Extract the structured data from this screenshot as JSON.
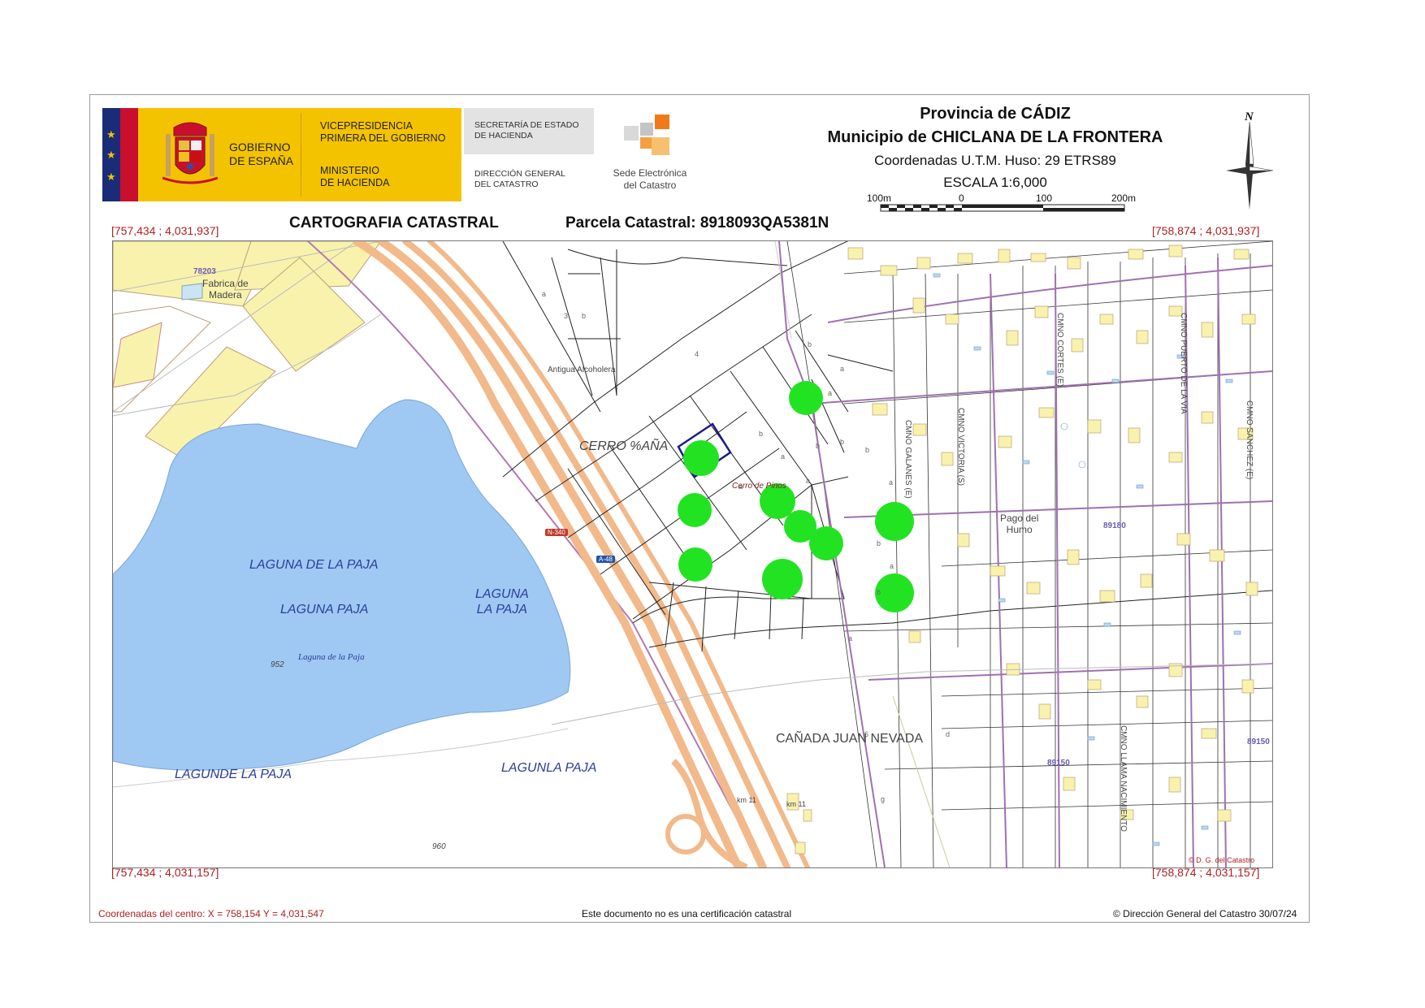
{
  "header": {
    "government": "GOBIERNO\nDE ESPAÑA",
    "vicepresidencia": "VICEPRESIDENCIA\nPRIMERA DEL GOBIERNO",
    "ministerio": "MINISTERIO\nDE HACIENDA",
    "secretaria": "SECRETARÍA DE ESTADO\nDE HACIENDA",
    "direccion": "DIRECCIÓN GENERAL\nDEL CATASTRO",
    "sede": "Sede Electrónica\ndel Catastro"
  },
  "titles": {
    "provincia": "Provincia de CÁDIZ",
    "municipio": "Municipio de CHICLANA DE LA FRONTERA",
    "coordenadas": "Coordenadas U.T.M. Huso: 29 ETRS89",
    "escala": "ESCALA 1:6,000",
    "scale_labels": [
      "100m",
      "0",
      "100",
      "200m"
    ],
    "north": "N",
    "cartografia": "CARTOGRAFIA CATASTRAL",
    "parcela": "Parcela Catastral: 8918093QA5381N"
  },
  "corners": {
    "top_left": "[757,434 ; 4,031,937]",
    "top_right": "[758,874 ; 4,031,937]",
    "bottom_left": "[757,434 ; 4,031,157]",
    "bottom_right": "[758,874 ; 4,031,157]"
  },
  "map_labels": {
    "zone_78203": "78203",
    "fabrica": "Fabrica de\nMadera",
    "antigua": "Antigua Alcoholera",
    "cerro": "CERRO %AÑA",
    "cerro_pinos": "Cerro de Pinos",
    "laguna_main": "LAGUNA DE LA PAJA",
    "laguna_2": "LAGUNA  PAJA",
    "laguna_3": "LAGUNA\nLA PAJA",
    "laguna_small": "Laguna de la Paja",
    "laguna_4": "LAGUNDE LA  PAJA",
    "laguna_5": "LAGUNLA    PAJA",
    "n952": "952",
    "n960": "960",
    "canada": "CAÑADA JUAN NEVADA",
    "pago": "Pago del\nHumo",
    "zone_89180": "89180",
    "zone_89150": "89150",
    "zone_89150b": "89150",
    "km11a": "km 11",
    "km11b": "km 11",
    "road_n340": "N-340",
    "road_a48": "A-48",
    "camino_cortes": "CMNO CORTES (E)",
    "camino_puerto": "CMNO PUERTO DE LA VIA",
    "camino_victoria": "CMNO VICTORIA (S)",
    "camino_sanchez": "CMNO SANCHEZ (E)",
    "camino_galanes": "CMNO GALANES (E)",
    "camino_llama": "CMNO LLAMA NACIMIENTO",
    "copyright_map": "© D. G. del Catastro"
  },
  "footer": {
    "centro": "Coordenadas del centro: X = 758,154 Y = 4,031,547",
    "nota": "Este documento no es una certificación catastral",
    "copyright": "© Dirección General del Catastro 30/07/24"
  },
  "colors": {
    "lagoon": "#9fc8f3",
    "industrial": "#f8f2ad",
    "highway": "#f2b98a",
    "marker": "#22e322",
    "boundary": "#8a5aa8",
    "selected_parcel": "#1c1c8a"
  }
}
